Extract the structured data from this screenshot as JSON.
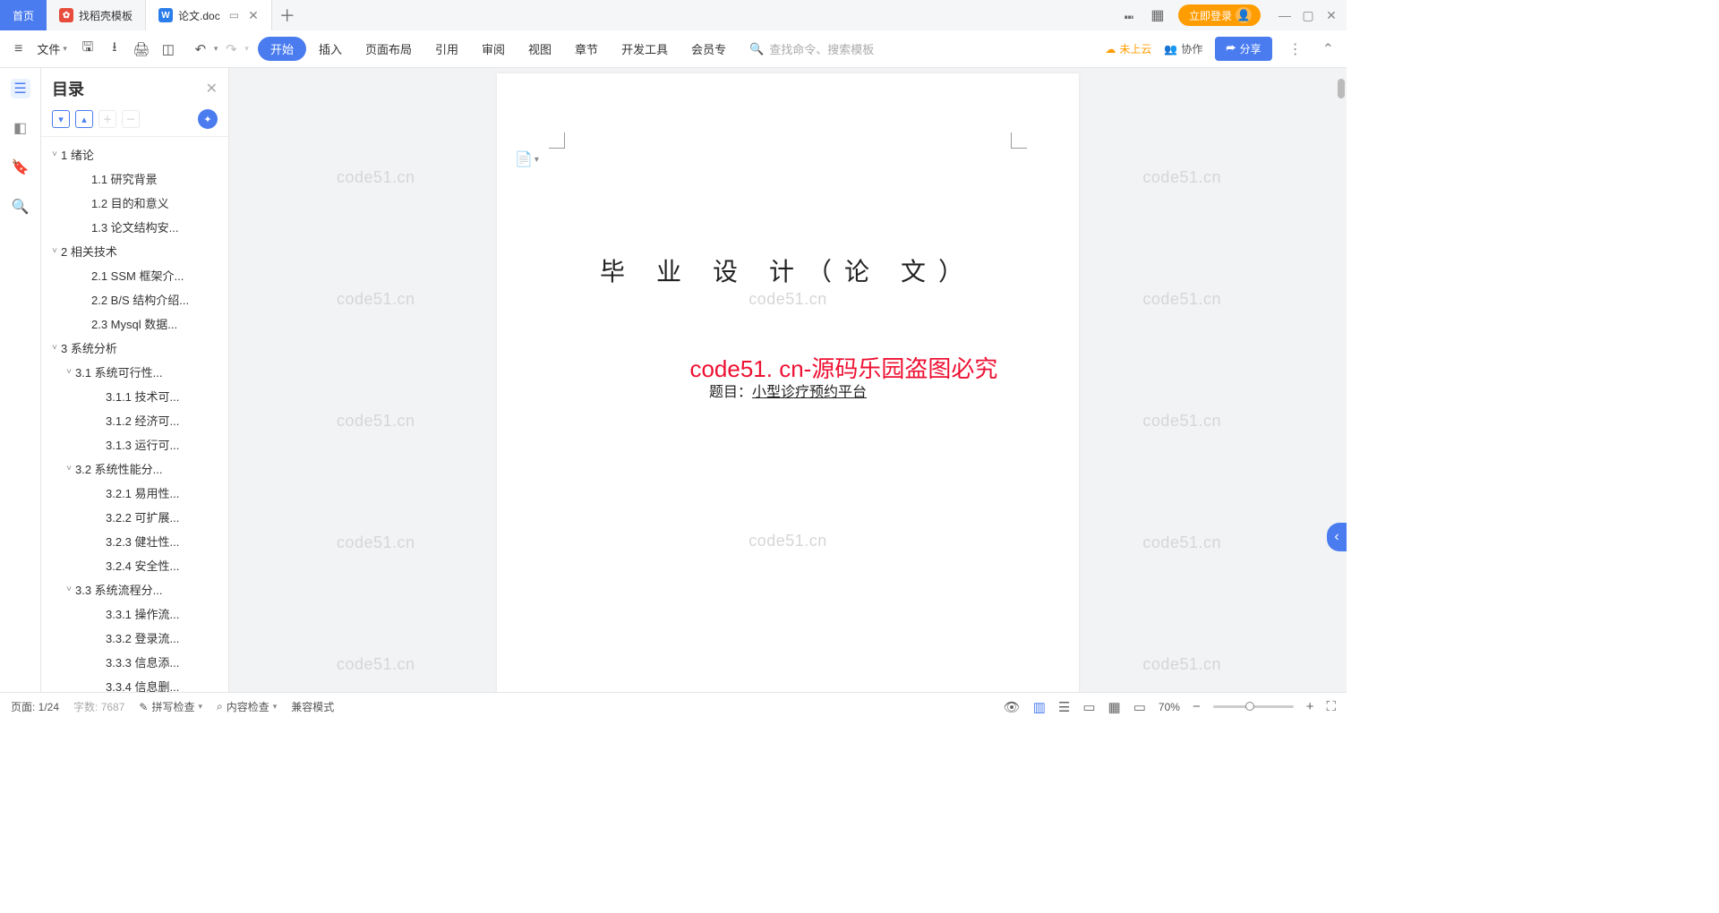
{
  "tabs": {
    "home": "首页",
    "t1": "找稻壳模板",
    "t2": "论文.doc"
  },
  "login": "立即登录",
  "fileMenu": "文件",
  "menus": [
    "开始",
    "插入",
    "页面布局",
    "引用",
    "审阅",
    "视图",
    "章节",
    "开发工具",
    "会员专"
  ],
  "searchPlaceholder": "查找命令、搜索模板",
  "cloud": "未上云",
  "collab": "协作",
  "share": "分享",
  "outline": {
    "title": "目录",
    "items": [
      {
        "lvl": 1,
        "chev": "˅",
        "txt": "1  绪论"
      },
      {
        "lvl": 3,
        "txt": "1.1  研究背景"
      },
      {
        "lvl": 3,
        "txt": "1.2  目的和意义"
      },
      {
        "lvl": 3,
        "txt": "1.3  论文结构安..."
      },
      {
        "lvl": 1,
        "chev": "˅",
        "txt": "2  相关技术"
      },
      {
        "lvl": 3,
        "txt": "2.1  SSM 框架介..."
      },
      {
        "lvl": 3,
        "txt": "2.2  B/S 结构介绍..."
      },
      {
        "lvl": 3,
        "txt": "2.3  Mysql 数据..."
      },
      {
        "lvl": 1,
        "chev": "˅",
        "txt": "3  系统分析"
      },
      {
        "lvl": 2,
        "chev": "˅",
        "txt": "3.1  系统可行性..."
      },
      {
        "lvl": 4,
        "txt": "3.1.1  技术可..."
      },
      {
        "lvl": 4,
        "txt": "3.1.2  经济可..."
      },
      {
        "lvl": 4,
        "txt": "3.1.3  运行可..."
      },
      {
        "lvl": 2,
        "chev": "˅",
        "txt": "3.2  系统性能分..."
      },
      {
        "lvl": 4,
        "txt": "3.2.1  易用性..."
      },
      {
        "lvl": 4,
        "txt": "3.2.2  可扩展..."
      },
      {
        "lvl": 4,
        "txt": "3.2.3  健壮性..."
      },
      {
        "lvl": 4,
        "txt": "3.2.4  安全性..."
      },
      {
        "lvl": 2,
        "chev": "˅",
        "txt": "3.3  系统流程分..."
      },
      {
        "lvl": 4,
        "txt": "3.3.1  操作流..."
      },
      {
        "lvl": 4,
        "txt": "3.3.2  登录流..."
      },
      {
        "lvl": 4,
        "txt": "3.3.3  信息添..."
      },
      {
        "lvl": 4,
        "txt": "3.3.4  信息删..."
      }
    ]
  },
  "doc": {
    "title": "毕 业 设 计（论 文）",
    "subjectLabel": "题目：",
    "subjectValue": "小型诊疗预约平台"
  },
  "watermark": "code51.cn",
  "overlay": "code51. cn-源码乐园盗图必究",
  "status": {
    "page": "页面: 1/24",
    "words": "字数: 7687",
    "spellcheck": "拼写检查",
    "contentcheck": "内容检查",
    "compat": "兼容模式",
    "zoom": "70%"
  }
}
